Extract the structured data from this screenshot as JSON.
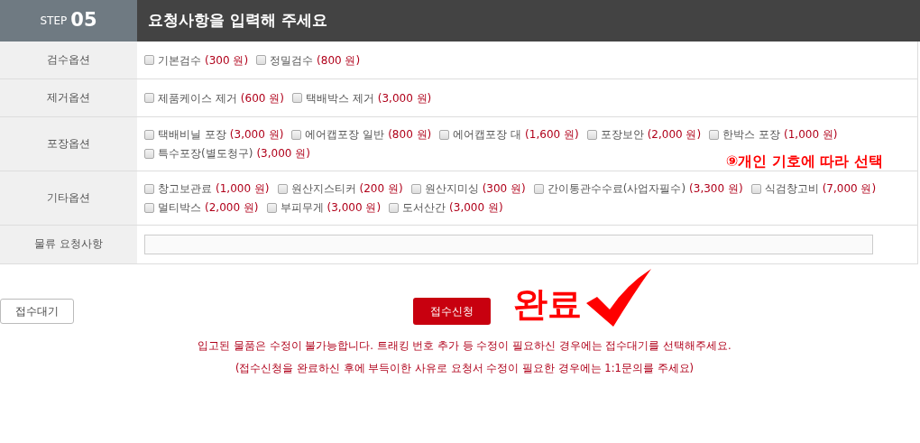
{
  "step": {
    "label": "STEP",
    "number": "05"
  },
  "title": "요청사항을 입력해 주세요",
  "rows": [
    {
      "label": "검수옵션",
      "kind": "options",
      "options": [
        {
          "name": "기본검수",
          "price": "(300 원)",
          "checked": false
        },
        {
          "name": "정밀검수",
          "price": "(800 원)",
          "checked": false
        }
      ]
    },
    {
      "label": "제거옵션",
      "kind": "options",
      "options": [
        {
          "name": "제품케이스 제거",
          "price": "(600 원)",
          "checked": false
        },
        {
          "name": "택배박스 제거",
          "price": "(3,000 원)",
          "checked": false
        }
      ]
    },
    {
      "label": "포장옵션",
      "kind": "options",
      "annotation": "⑨개인 기호에 따라 선택",
      "options": [
        {
          "name": "택배비닐 포장",
          "price": "(3,000 원)",
          "checked": false
        },
        {
          "name": "에어캡포장 일반",
          "price": "(800 원)",
          "checked": false
        },
        {
          "name": "에어캡포장 대",
          "price": "(1,600 원)",
          "checked": false
        },
        {
          "name": "포장보안",
          "price": "(2,000 원)",
          "checked": false
        },
        {
          "name": "한박스 포장",
          "price": "(1,000 원)",
          "checked": false
        },
        {
          "name": "특수포장(별도청구)",
          "price": "(3,000 원)",
          "checked": false
        }
      ]
    },
    {
      "label": "기타옵션",
      "kind": "options",
      "options": [
        {
          "name": "창고보관료",
          "price": "(1,000 원)",
          "checked": false
        },
        {
          "name": "원산지스티커",
          "price": "(200 원)",
          "checked": false
        },
        {
          "name": "원산지미싱",
          "price": "(300 원)",
          "checked": false
        },
        {
          "name": "간이통관수수료(사업자필수)",
          "price": "(3,300 원)",
          "checked": false
        },
        {
          "name": "식검창고비",
          "price": "(7,000 원)",
          "checked": false
        },
        {
          "name": "멀티박스",
          "price": "(2,000 원)",
          "checked": false
        },
        {
          "name": "부피무게",
          "price": "(3,000 원)",
          "checked": false
        },
        {
          "name": "도서산간",
          "price": "(3,000 원)",
          "checked": false
        }
      ]
    },
    {
      "label": "물류 요청사항",
      "kind": "text"
    }
  ],
  "wait_button": "접수대기",
  "submit_button": "접수신청",
  "done_mark": "완료",
  "notices": [
    "입고된 물품은 수정이 불가능합니다. 트래킹 번호 추가 등 수정이 필요하신 경우에는 접수대기를 선택해주세요.",
    "(접수신청을 완료하신 후에 부득이한 사유로 요청서 수정이 필요한 경우에는 1:1문의를 주세요)"
  ]
}
